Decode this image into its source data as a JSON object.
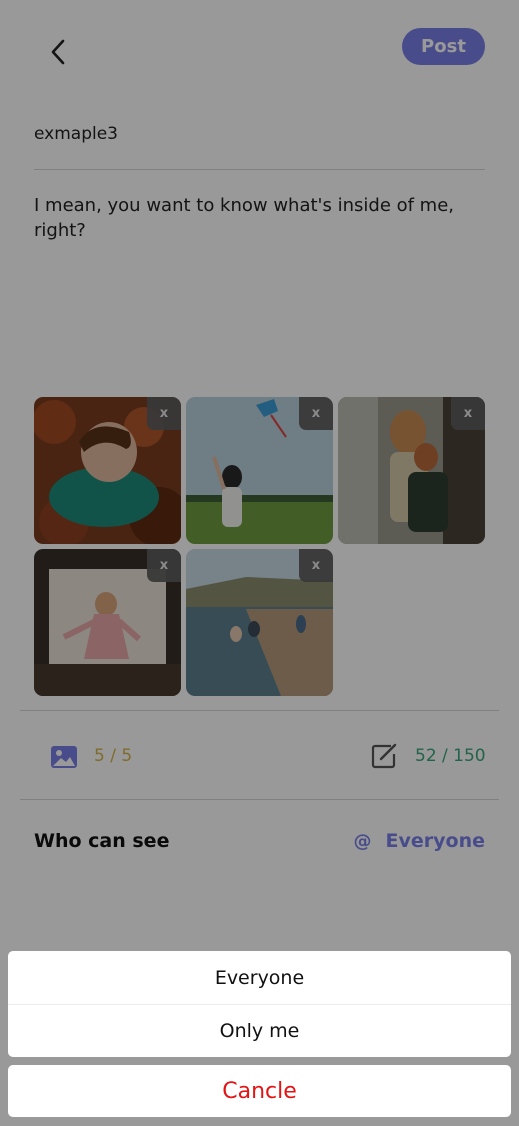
{
  "header": {
    "back_icon": "chevron-left-icon",
    "post_label": "Post"
  },
  "post": {
    "title": "exmaple3",
    "body": "I mean, you want to know what's inside of me, right?"
  },
  "photos": {
    "remove_label": "x",
    "items": [
      {
        "name": "photo-child-in-leaves"
      },
      {
        "name": "photo-girl-with-kite"
      },
      {
        "name": "photo-two-kids-by-tree"
      },
      {
        "name": "photo-girl-dancing"
      },
      {
        "name": "photo-beach-kids"
      }
    ]
  },
  "stats": {
    "image_count": "5 / 5",
    "char_count": "52 / 150",
    "image_count_color": "#d4b54a",
    "char_count_color": "#3aa57a"
  },
  "visibility": {
    "label": "Who can see",
    "at_symbol": "@",
    "value": "Everyone"
  },
  "action_sheet": {
    "options": [
      "Everyone",
      "Only me"
    ],
    "cancel_label": "Cancle"
  },
  "colors": {
    "accent": "#7b7fe8",
    "danger": "#e41414"
  }
}
